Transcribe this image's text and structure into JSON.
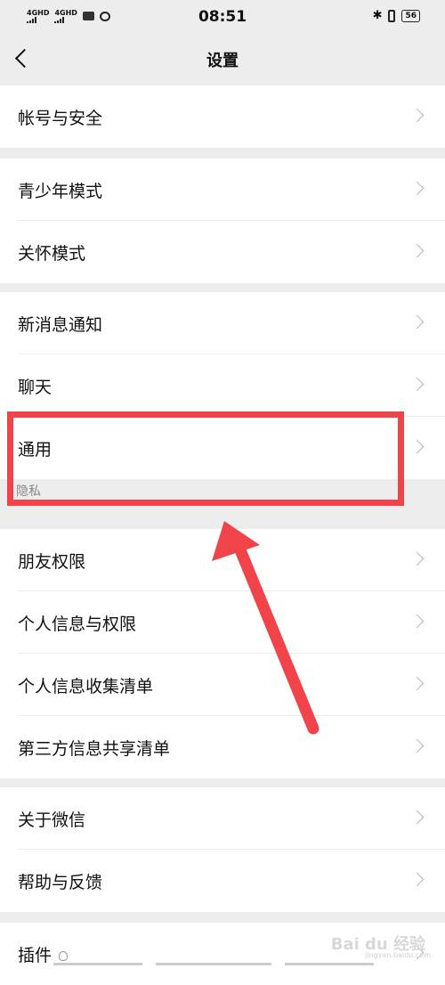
{
  "status_bar": {
    "signal1": "4GHD",
    "signal2": "4GHD",
    "time": "08:51",
    "battery": "56"
  },
  "nav": {
    "title": "设置"
  },
  "items": {
    "account_security": "帐号与安全",
    "youth_mode": "青少年模式",
    "care_mode": "关怀模式",
    "new_message": "新消息通知",
    "chat": "聊天",
    "general": "通用",
    "friend_permissions": "朋友权限",
    "personal_info_permissions": "个人信息与权限",
    "personal_info_collection": "个人信息收集清单",
    "third_party_sharing": "第三方信息共享清单",
    "about_wechat": "关于微信",
    "help_feedback": "帮助与反馈",
    "plugins": "插件"
  },
  "section_headers": {
    "privacy": "隐私"
  },
  "annotation": {
    "color": "#f0444a"
  },
  "watermark": {
    "text": "Bai du 经验",
    "sub": "jingyan.baidu.com"
  }
}
